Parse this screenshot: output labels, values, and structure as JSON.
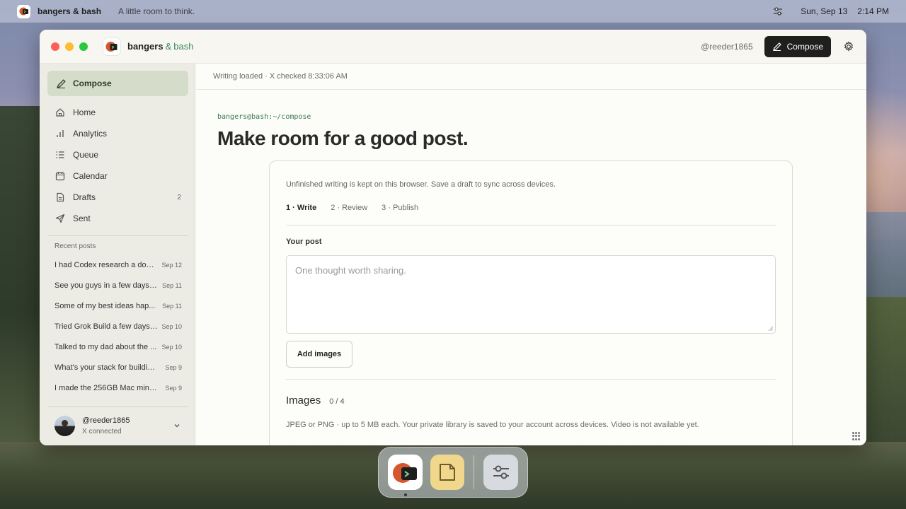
{
  "menubar": {
    "app_name": "bangers & bash",
    "tagline": "A little room to think.",
    "date": "Sun, Sep 13",
    "time": "2:14 PM"
  },
  "window": {
    "brand_name": "bangers",
    "brand_amp": "&",
    "brand_suffix": "bash",
    "handle": "@reeder1865",
    "compose_label": "Compose"
  },
  "sidebar": {
    "compose_label": "Compose",
    "nav": [
      {
        "label": "Home",
        "icon": "home-icon"
      },
      {
        "label": "Analytics",
        "icon": "analytics-icon"
      },
      {
        "label": "Queue",
        "icon": "queue-icon"
      },
      {
        "label": "Calendar",
        "icon": "calendar-icon"
      },
      {
        "label": "Drafts",
        "icon": "drafts-icon",
        "count": "2"
      },
      {
        "label": "Sent",
        "icon": "sent-icon"
      }
    ],
    "recent_title": "Recent posts",
    "recent": [
      {
        "title": "I had Codex research a dom...",
        "date": "Sep 12"
      },
      {
        "title": "See you guys in a few days. ...",
        "date": "Sep 11"
      },
      {
        "title": "Some of my best ideas hap...",
        "date": "Sep 11"
      },
      {
        "title": "Tried Grok Build a few days ...",
        "date": "Sep 10"
      },
      {
        "title": "Talked to my dad about the ...",
        "date": "Sep 10"
      },
      {
        "title": "What's your stack for buildin...",
        "date": "Sep 9"
      },
      {
        "title": "I made the 256GB Mac mini ...",
        "date": "Sep 9"
      }
    ],
    "account": {
      "handle": "@reeder1865",
      "status": "X connected"
    }
  },
  "main": {
    "status": "Writing loaded · X checked 8:33:06 AM",
    "prompt": "bangers@bash:~/compose",
    "headline": "Make room for a good post.",
    "card": {
      "note": "Unfinished writing is kept on this browser. Save a draft to sync across devices.",
      "steps": [
        "1 · Write",
        "2 · Review",
        "3 · Publish"
      ],
      "post_label": "Your post",
      "post_placeholder": "One thought worth sharing.",
      "add_images": "Add images",
      "images_title": "Images",
      "images_count": "0 / 4",
      "images_note": "JPEG or PNG · up to 5 MB each. Your private library is saved to your account across devices. Video is not available yet."
    }
  },
  "colors": {
    "accent_green": "#3a8a5a",
    "compose_bg": "#1f1f1d",
    "sidebar_active": "#d5ddca"
  }
}
